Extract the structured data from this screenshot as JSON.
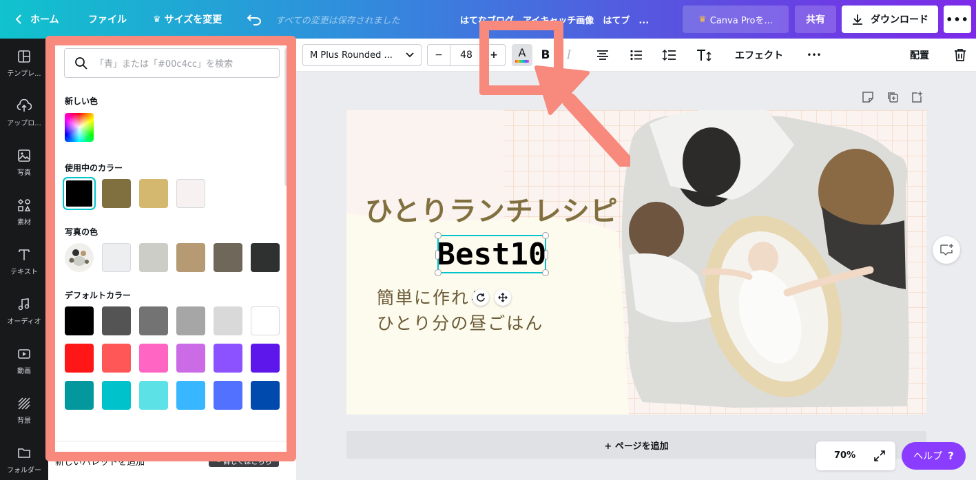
{
  "topbar": {
    "home": "ホーム",
    "file": "ファイル",
    "resize": "サイズを変更",
    "saved_status": "すべての変更は保存されました",
    "document_title": "はてなブログ　アイキャッチ画像　はてブ　...",
    "pro_button": "Canva Proを...",
    "share": "共有",
    "download": "ダウンロード"
  },
  "sidebar": {
    "items": [
      {
        "label": "テンプレ...",
        "icon": "layout-icon"
      },
      {
        "label": "アップロ...",
        "icon": "upload-cloud-icon"
      },
      {
        "label": "写真",
        "icon": "photo-icon"
      },
      {
        "label": "素材",
        "icon": "shapes-icon"
      },
      {
        "label": "テキスト",
        "icon": "text-icon"
      },
      {
        "label": "オーディオ",
        "icon": "music-note-icon"
      },
      {
        "label": "動画",
        "icon": "video-icon"
      },
      {
        "label": "背景",
        "icon": "background-icon"
      },
      {
        "label": "フォルダー",
        "icon": "folder-icon"
      }
    ]
  },
  "color_panel": {
    "search_placeholder": "「青」または「#00c4cc」を検索",
    "new_color_title": "新しい色",
    "in_use_title": "使用中のカラー",
    "in_use_colors": [
      "#000000",
      "#80703f",
      "#d4b86f",
      "#f7f2f1"
    ],
    "photo_title": "写真の色",
    "photo_colors": [
      "#eceeef",
      "#cccdc6",
      "#b59a73",
      "#6f6759",
      "#2f3130"
    ],
    "default_title": "デフォルトカラー",
    "default_colors": [
      [
        "#000000",
        "#545454",
        "#737373",
        "#a6a6a6",
        "#d9d9d9",
        "#ffffff"
      ],
      [
        "#ff1616",
        "#ff5757",
        "#ff66c4",
        "#cb6ce6",
        "#8c52ff",
        "#5e17eb"
      ],
      [
        "#03989e",
        "#00c2cb",
        "#5ce1e6",
        "#38b6ff",
        "#5271ff",
        "#004aad"
      ],
      [
        "#008037",
        "#7ed957",
        "#c9e265",
        "#ffde59",
        "#ffbd59",
        "#ff914d"
      ]
    ],
    "footer_text": "新しいパレットを追加",
    "footer_badge": "詳しくはこちら"
  },
  "toolbar": {
    "font_name": "M Plus Rounded ...",
    "minus": "−",
    "font_size": "48",
    "plus": "+",
    "text_color_letter": "A",
    "bold": "B",
    "italic": "I",
    "effects": "エフェクト",
    "more": "•••",
    "position": "配置"
  },
  "design": {
    "title": "ひとりランチレシピ",
    "selected_text": "Best10",
    "subtitle_line1": "簡単に作れる",
    "subtitle_line2": "ひとり分の昼ごはん"
  },
  "canvas": {
    "add_page": "+ ページを追加",
    "zoom": "70%",
    "help": "ヘルプ",
    "help_icon": "?"
  },
  "colors": {
    "accent_teal": "#00c4cc",
    "accent_purple": "#8b3dff",
    "annotation_salmon": "#f7897d",
    "title_olive": "#80703f"
  }
}
